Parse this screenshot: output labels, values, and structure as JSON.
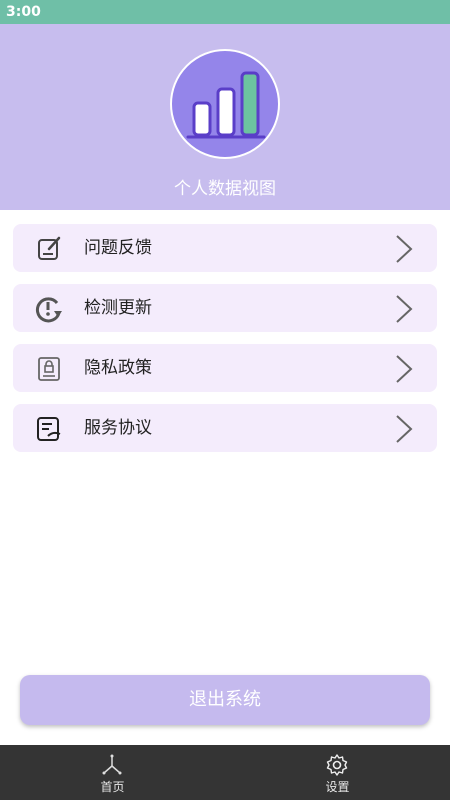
{
  "status_bar": {
    "time": "3:00"
  },
  "header": {
    "title": "个人数据视图"
  },
  "menu": [
    {
      "label": "问题反馈",
      "icon": "feedback-edit-icon"
    },
    {
      "label": "检测更新",
      "icon": "update-check-icon"
    },
    {
      "label": "隐私政策",
      "icon": "privacy-lock-icon"
    },
    {
      "label": "服务协议",
      "icon": "agreement-document-icon"
    }
  ],
  "logout": {
    "label": "退出系统"
  },
  "bottom_nav": [
    {
      "label": "首页",
      "icon": "home-network-icon"
    },
    {
      "label": "设置",
      "icon": "gear-icon"
    }
  ],
  "colors": {
    "accent": "#c7bdee",
    "status": "#6fbfa7",
    "nav_bg": "#343434",
    "item_bg": "#f4ecfc"
  }
}
